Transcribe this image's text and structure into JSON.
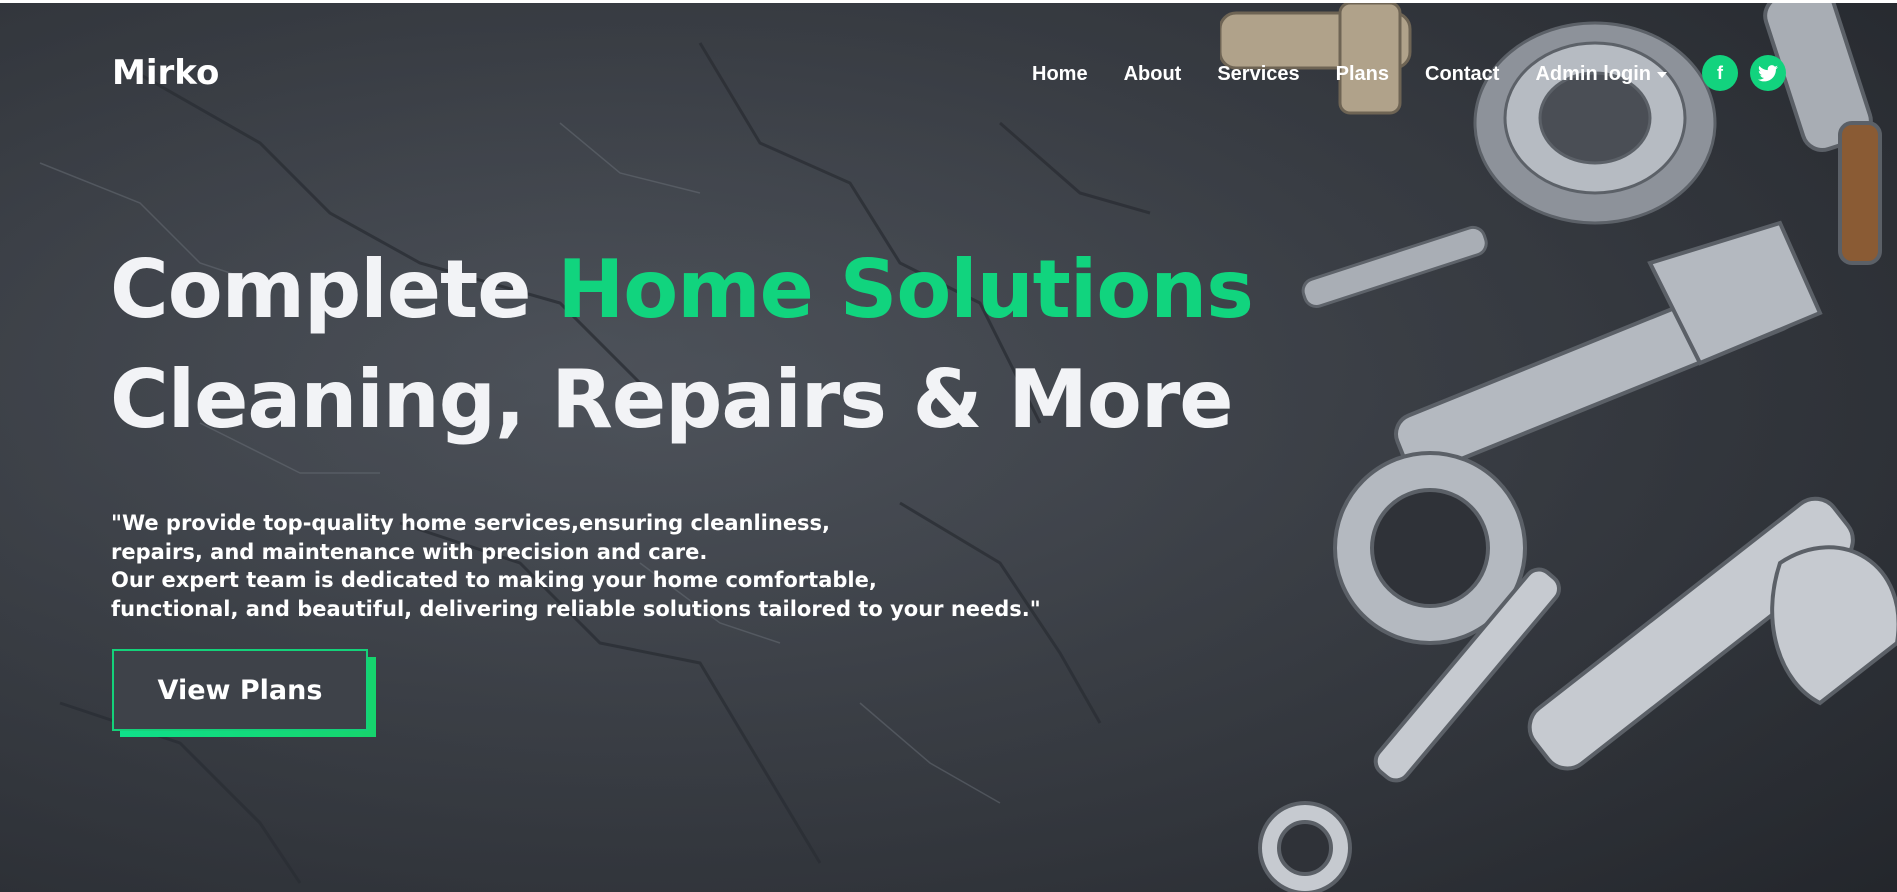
{
  "brand": {
    "name": "Mirko"
  },
  "nav": {
    "items": [
      "Home",
      "About",
      "Services",
      "Plans",
      "Contact"
    ],
    "dropdown_label": "Admin login"
  },
  "social": [
    {
      "icon": "facebook-icon",
      "glyph": "f"
    },
    {
      "icon": "twitter-icon"
    }
  ],
  "hero": {
    "headline_part1": "Complete ",
    "headline_accent": "Home Solutions",
    "headline_line2": "Cleaning, Repairs & More",
    "tagline_lines": [
      "\"We provide top-quality home services,ensuring cleanliness,",
      "repairs, and maintenance with precision and care.",
      "Our expert team is dedicated to making your home comfortable,",
      "functional, and beautiful, delivering reliable solutions tailored to your needs.\""
    ],
    "cta_label": "View Plans",
    "background_image": "dark slate surface with wrenches and metal tools"
  },
  "colors": {
    "accent": "#11d47e",
    "text": "#ffffff",
    "background": "#3a3e45"
  }
}
